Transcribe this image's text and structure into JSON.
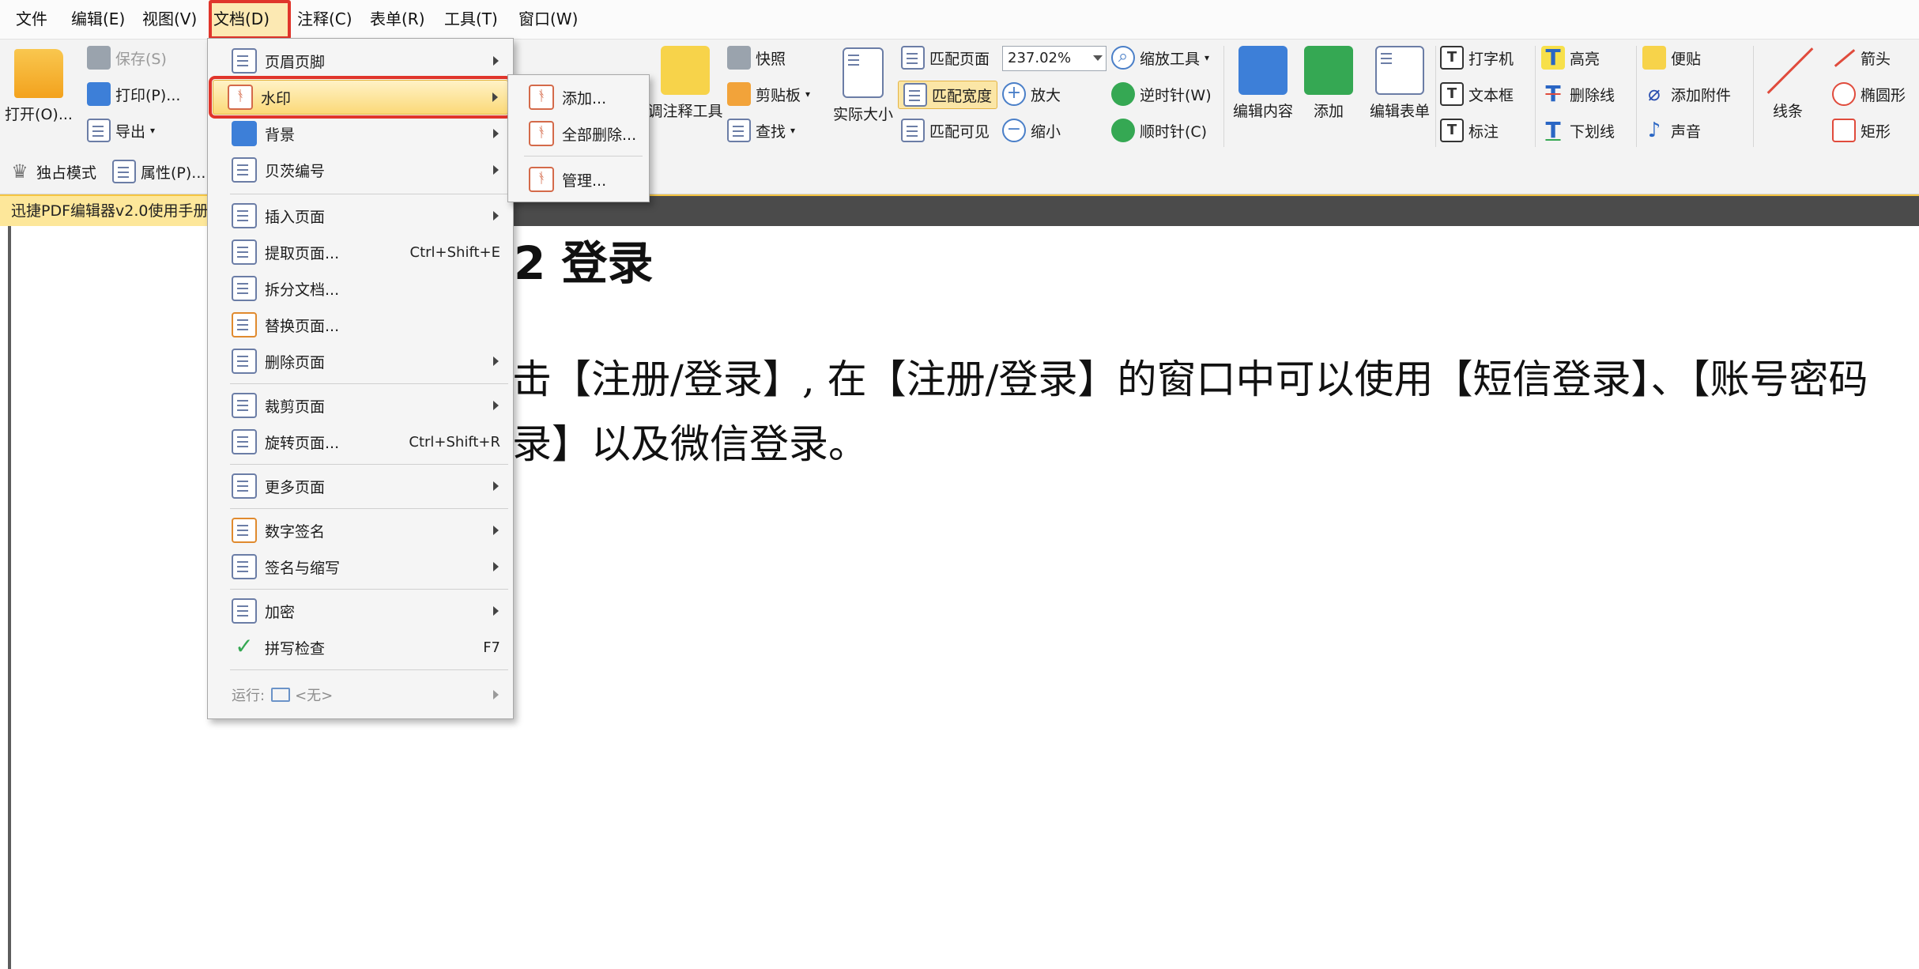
{
  "menubar": {
    "items": [
      "文件",
      "编辑(E)",
      "视图(V)",
      "文档(D)",
      "注释(C)",
      "表单(R)",
      "工具(T)",
      "窗口(W)"
    ],
    "active_index": 3
  },
  "ribbon": {
    "open": "打开(O)...",
    "save": "保存(S)",
    "print": "打印(P)...",
    "export": "导出",
    "exclusive_mode": "独占模式",
    "properties": "属性(P)...",
    "annotation_tool": "调注释工具",
    "snapshot": "快照",
    "clipboard": "剪贴板",
    "find": "查找",
    "actual_size": "实际大小",
    "fit_page": "匹配页面",
    "fit_width": "匹配宽度",
    "fit_visible": "匹配可见",
    "zoom_value": "237.02%",
    "zoom_tool": "缩放工具",
    "zoom_in": "放大",
    "zoom_out": "缩小",
    "rotate_ccw": "逆时针(W)",
    "rotate_cw": "顺时针(C)",
    "edit_content": "编辑内容",
    "add": "添加",
    "edit_form": "编辑表单",
    "typewriter": "打字机",
    "textbox": "文本框",
    "callout": "标注",
    "highlight": "高亮",
    "strikeout": "删除线",
    "underline": "下划线",
    "sticky_note": "便贴",
    "attach_file": "添加附件",
    "sound": "声音",
    "line": "线条",
    "arrow": "箭头",
    "ellipse": "椭圆形",
    "rectangle": "矩形"
  },
  "tab": {
    "title": "迅捷PDF编辑器v2.0使用手册"
  },
  "document": {
    "heading": "2  登录",
    "para1": "击【注册/登录】, 在【注册/登录】的窗口中可以使用【短信登录】、【账号密码",
    "para2": "录】以及微信登录。"
  },
  "doc_menu": {
    "header_footer": "页眉页脚",
    "watermark": "水印",
    "background": "背景",
    "bates": "贝茨编号",
    "insert_pages": "插入页面",
    "extract_pages": "提取页面...",
    "extract_shortcut": "Ctrl+Shift+E",
    "split_document": "拆分文档...",
    "replace_pages": "替换页面...",
    "delete_pages": "删除页面",
    "crop_pages": "裁剪页面",
    "rotate_pages": "旋转页面...",
    "rotate_shortcut": "Ctrl+Shift+R",
    "more_pages": "更多页面",
    "digital_signature": "数字签名",
    "sign_initials": "签名与缩写",
    "encrypt": "加密",
    "spell_check": "拼写检查",
    "spell_shortcut": "F7",
    "run_label": "运行:",
    "run_value": "<无>"
  },
  "watermark_submenu": {
    "add": "添加...",
    "remove_all": "全部删除...",
    "manage": "管理..."
  }
}
